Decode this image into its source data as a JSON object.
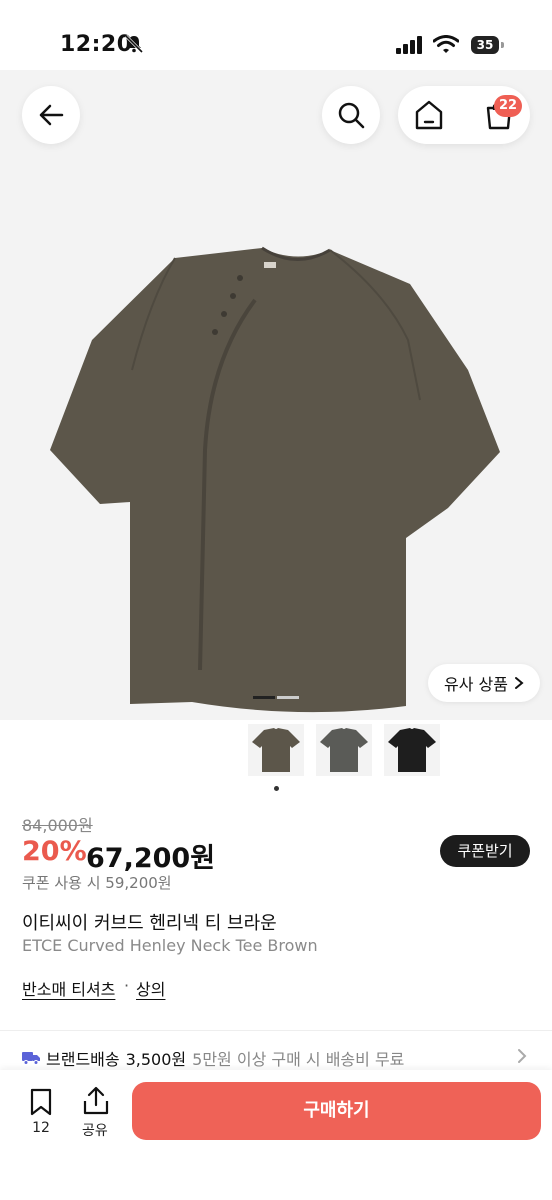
{
  "status_bar": {
    "time": "12:20",
    "battery": "35"
  },
  "header": {
    "cart_count": "22"
  },
  "similar_products_label": "유사 상품",
  "price": {
    "original": "84,000원",
    "discount": "20%",
    "current": "67,200원",
    "coupon_button": "쿠폰받기",
    "coupon_price_text": "쿠폰 사용 시 59,200원"
  },
  "product": {
    "title_ko": "이티씨이 커브드 헨리넥 티 브라운",
    "title_en": "ETCE Curved Henley Neck Tee Brown"
  },
  "categories": [
    {
      "label": "반소매 티셔츠"
    },
    {
      "label": "상의"
    }
  ],
  "category_separator": "·",
  "shipping": {
    "label": "브랜드배송",
    "fee": "3,500원",
    "note": "5만원 이상 구매 시 배송비 무료"
  },
  "bottom_bar": {
    "bookmark_count": "12",
    "share_label": "공유",
    "buy_label": "구매하기"
  },
  "thumbnails": [
    {
      "color": "#5c564a",
      "name": "brown"
    },
    {
      "color": "#5a5b57",
      "name": "charcoal"
    },
    {
      "color": "#1e1e1e",
      "name": "black"
    }
  ],
  "gallery": {
    "current": 1,
    "total": 2
  },
  "colors": {
    "accent": "#ea5a4e",
    "buy_button": "#ef6257",
    "dark_button": "#1c1c1c",
    "garment": "#5c564a"
  }
}
